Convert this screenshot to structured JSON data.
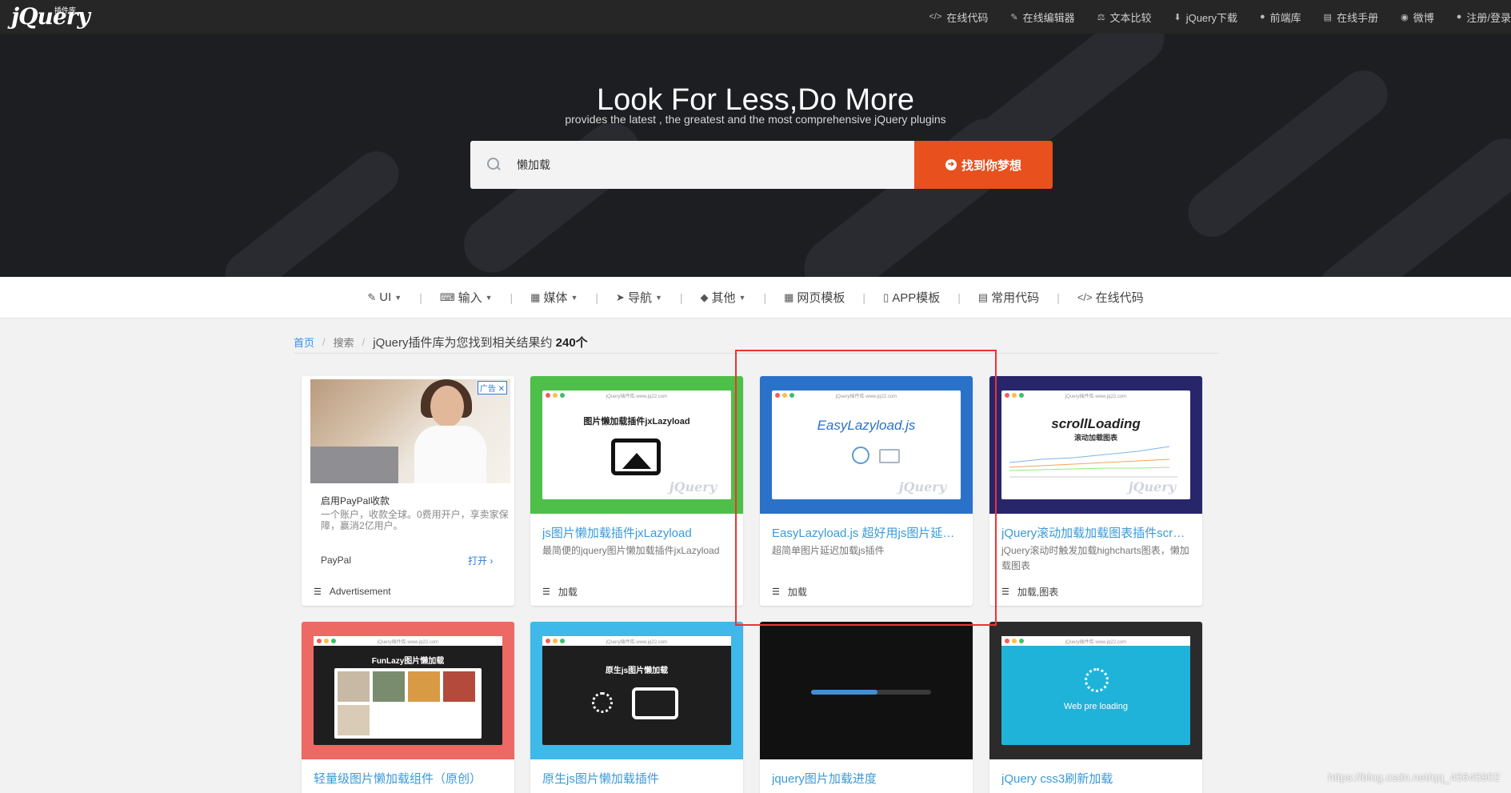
{
  "topbar": {
    "logo": "jQuery",
    "logo_cn": "插件库",
    "nav": [
      {
        "icon": "code-icon",
        "label": "在线代码"
      },
      {
        "icon": "edit-icon",
        "label": "在线编辑器"
      },
      {
        "icon": "scale-icon",
        "label": "文本比较"
      },
      {
        "icon": "download-icon",
        "label": "jQuery下载"
      },
      {
        "icon": "user-icon",
        "label": "前端库"
      },
      {
        "icon": "book-icon",
        "label": "在线手册"
      },
      {
        "icon": "weibo-icon",
        "label": "微博"
      },
      {
        "icon": "user-icon",
        "label": "注册/登录"
      }
    ]
  },
  "hero": {
    "title": "Look For Less,Do More",
    "subtitle": "provides the latest , the greatest and the most comprehensive jQuery plugins",
    "search_value": "懒加载",
    "search_button": "找到你梦想"
  },
  "categories": [
    {
      "icon": "brush-icon",
      "label": "UI",
      "dropdown": true
    },
    {
      "icon": "keyboard-icon",
      "label": "输入",
      "dropdown": true
    },
    {
      "icon": "film-icon",
      "label": "媒体",
      "dropdown": true
    },
    {
      "icon": "send-icon",
      "label": "导航",
      "dropdown": true
    },
    {
      "icon": "dropbox-icon",
      "label": "其他",
      "dropdown": true
    },
    {
      "icon": "grid-icon",
      "label": "网页模板",
      "dropdown": false
    },
    {
      "icon": "mobile-icon",
      "label": "APP模板",
      "dropdown": false
    },
    {
      "icon": "file-code-icon",
      "label": "常用代码",
      "dropdown": false
    },
    {
      "icon": "code-icon",
      "label": "在线代码",
      "dropdown": false
    }
  ],
  "breadcrumb": {
    "home": "首页",
    "search": "搜索",
    "result_text": "jQuery插件库为您找到相关结果约",
    "result_count": "240个"
  },
  "ad": {
    "tag": "广告",
    "title": "启用PayPal收款",
    "desc": "一个账户，收款全球。0费用开户，享卖家保障，赢消2亿用户。",
    "brand": "PayPal",
    "open": "打开",
    "footer": "Advertisement"
  },
  "cards": [
    {
      "title": "js图片懒加载插件jxLazyload",
      "desc": "最简便的jquery图片懒加载插件jxLazyload",
      "tags": "加载",
      "thumb_text": "图片懒加载插件jxLazyload",
      "thumb_url": "jQuery插件库-www.jq22.com"
    },
    {
      "title": "EasyLazyload.js 超好用js图片延迟加载插件",
      "desc": "超简单图片延迟加载js插件",
      "tags": "加载",
      "thumb_text": "EasyLazyload.js",
      "thumb_url": "jQuery插件库-www.jq22.com"
    },
    {
      "title": "jQuery滚动加载加载图表插件scrollLoading",
      "desc": "jQuery滚动时触发加载highcharts图表，懒加载图表",
      "tags": "加载,图表",
      "thumb_text": "scrollLoading",
      "thumb_sub": "滚动加载图表",
      "thumb_url": "jQuery插件库-www.jq22.com"
    },
    {
      "title": "轻量级图片懒加载组件（原创）",
      "thumb_text": "FunLazy图片懒加载",
      "thumb_url": "jQuery插件库-www.jq22.com"
    },
    {
      "title": "原生js图片懒加载插件",
      "thumb_text": "原生js图片懒加载",
      "thumb_url": "jQuery插件库-www.jq22.com"
    },
    {
      "title": "jquery图片加载进度"
    },
    {
      "title": "jQuery css3刷新加载",
      "thumb_text": "Web pre loading",
      "thumb_url": "jQuery插件库-www.jq22.com"
    }
  ],
  "watermark": "https://blog.csdn.net/qq_45645902",
  "colors": {
    "accent": "#e8501d",
    "link": "#3a9ad9",
    "highlight": "#e33333"
  }
}
